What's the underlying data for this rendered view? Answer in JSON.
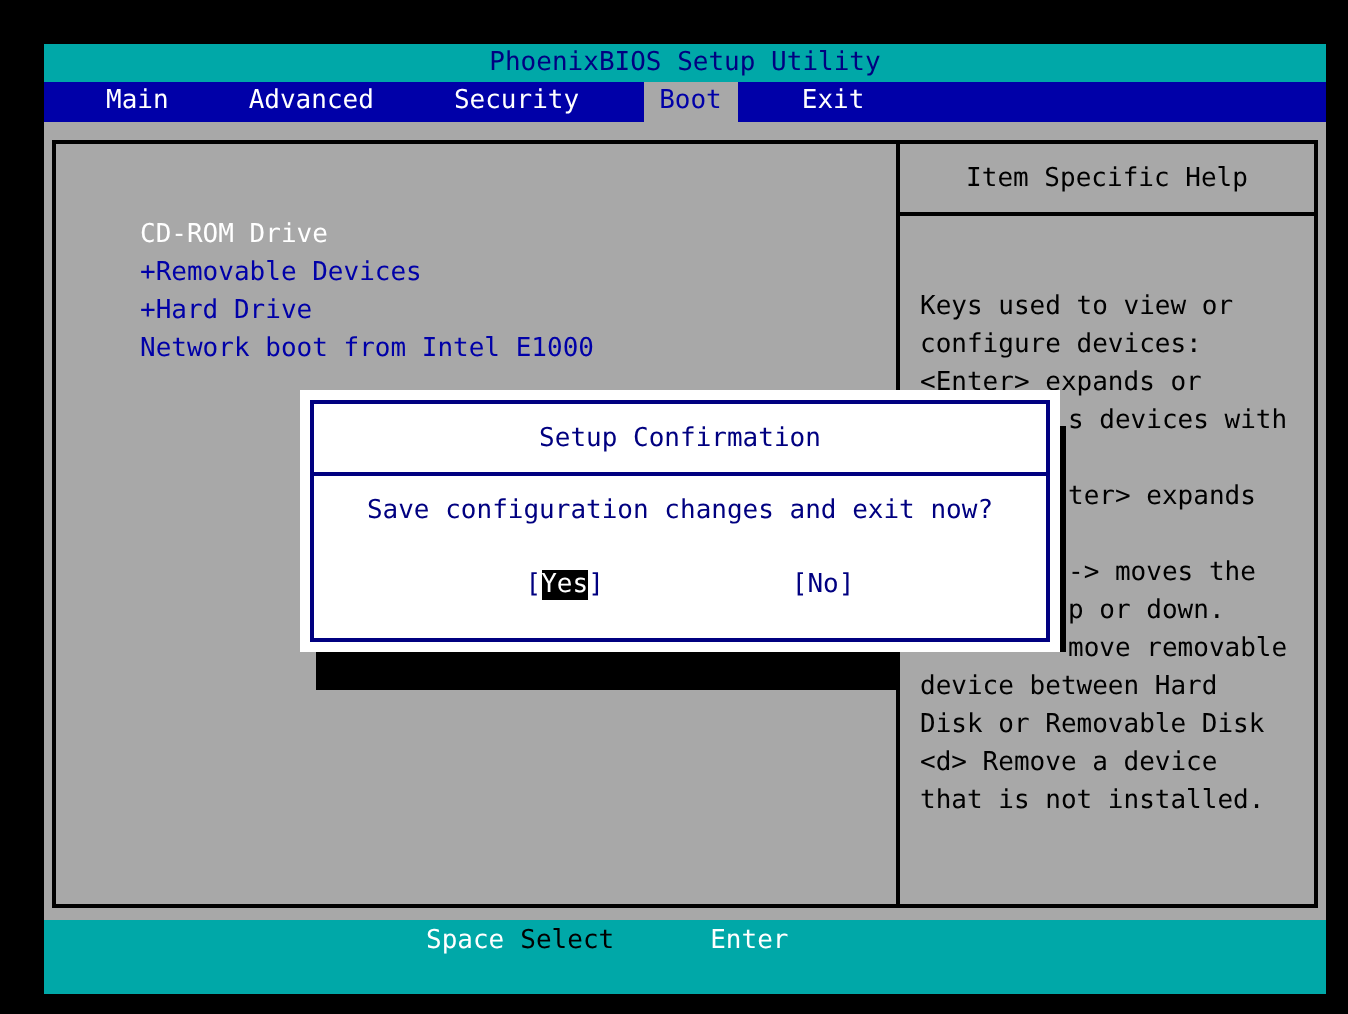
{
  "window": {
    "title": "PhoenixBIOS Setup Utility"
  },
  "menu": [
    {
      "label": "Main",
      "selected": false
    },
    {
      "label": "Advanced",
      "selected": false
    },
    {
      "label": "Security",
      "selected": false
    },
    {
      "label": "Boot",
      "selected": true
    },
    {
      "label": "Exit",
      "selected": false
    }
  ],
  "boot_items": [
    {
      "label": "CD-ROM Drive",
      "selected": true
    },
    {
      "label": "+Removable Devices",
      "selected": false
    },
    {
      "label": "+Hard Drive",
      "selected": false
    },
    {
      "label": "Network boot from Intel E1000",
      "selected": false
    }
  ],
  "help": {
    "title": "Item Specific Help",
    "lines": [
      {
        "text": "Keys used to view or",
        "kind": "full"
      },
      {
        "text": "configure devices:",
        "kind": "full"
      },
      {
        "text": "<Enter> expands or",
        "kind": "full"
      },
      {
        "text": "s devices with",
        "kind": "clipped"
      },
      {
        "kind": "blank"
      },
      {
        "text": "ter> expands",
        "kind": "clipped"
      },
      {
        "kind": "blank"
      },
      {
        "text": "-> moves the",
        "kind": "clipped"
      },
      {
        "text": "p or down.",
        "kind": "clipped"
      },
      {
        "text": "move removable",
        "kind": "clipped"
      },
      {
        "text": "device between Hard",
        "kind": "full"
      },
      {
        "text": "Disk or Removable Disk",
        "kind": "full"
      },
      {
        "text": "<d> Remove a device",
        "kind": "full"
      },
      {
        "text": "that is not installed.",
        "kind": "full"
      }
    ]
  },
  "dialog": {
    "title": "Setup Confirmation",
    "message": "Save configuration changes and exit now?",
    "buttons": [
      {
        "open": "[",
        "label": "Yes",
        "close": "]",
        "selected": true
      },
      {
        "open": "[",
        "label": "No",
        "close": "]",
        "selected": false
      }
    ]
  },
  "status_bar": [
    {
      "text": "Space",
      "kind": "key"
    },
    {
      "text": "Select",
      "kind": "action"
    },
    {
      "text": "Enter",
      "kind": "key"
    }
  ]
}
